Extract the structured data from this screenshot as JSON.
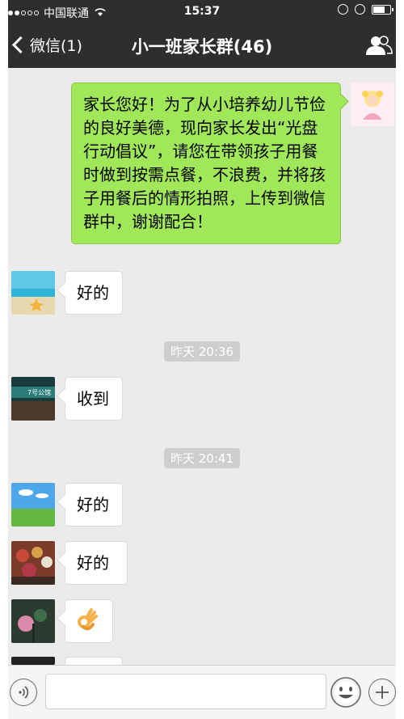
{
  "status_bar": {
    "carrier": "中国联通",
    "time": "15:37"
  },
  "nav": {
    "back_label": "微信(1)",
    "title": "小一班家长群(46)"
  },
  "messages": [
    {
      "side": "right",
      "text": "家长您好！为了从小培养幼儿节俭的良好美德，现向家长发出“光盘行动倡议”，请您在带领孩子用餐时做到按需点餐，不浪费，并将孩子用餐后的情形拍照，上传到微信群中，谢谢配合！"
    },
    {
      "side": "left",
      "text": "好的"
    },
    {
      "type": "time",
      "text": "昨天 20:36"
    },
    {
      "side": "left",
      "text": "收到",
      "avatar_text": "7号公馆"
    },
    {
      "type": "time",
      "text": "昨天 20:41"
    },
    {
      "side": "left",
      "text": "好的"
    },
    {
      "side": "left",
      "text": "好的"
    },
    {
      "side": "left",
      "text": "",
      "emoji": "ok-hand"
    }
  ],
  "input": {
    "value": "",
    "placeholder": ""
  },
  "colors": {
    "bar_bg": "#2e2e2e",
    "chat_bg": "#ebebeb",
    "green_bubble": "#a0e75a",
    "timestamp_bg": "#cecece"
  }
}
